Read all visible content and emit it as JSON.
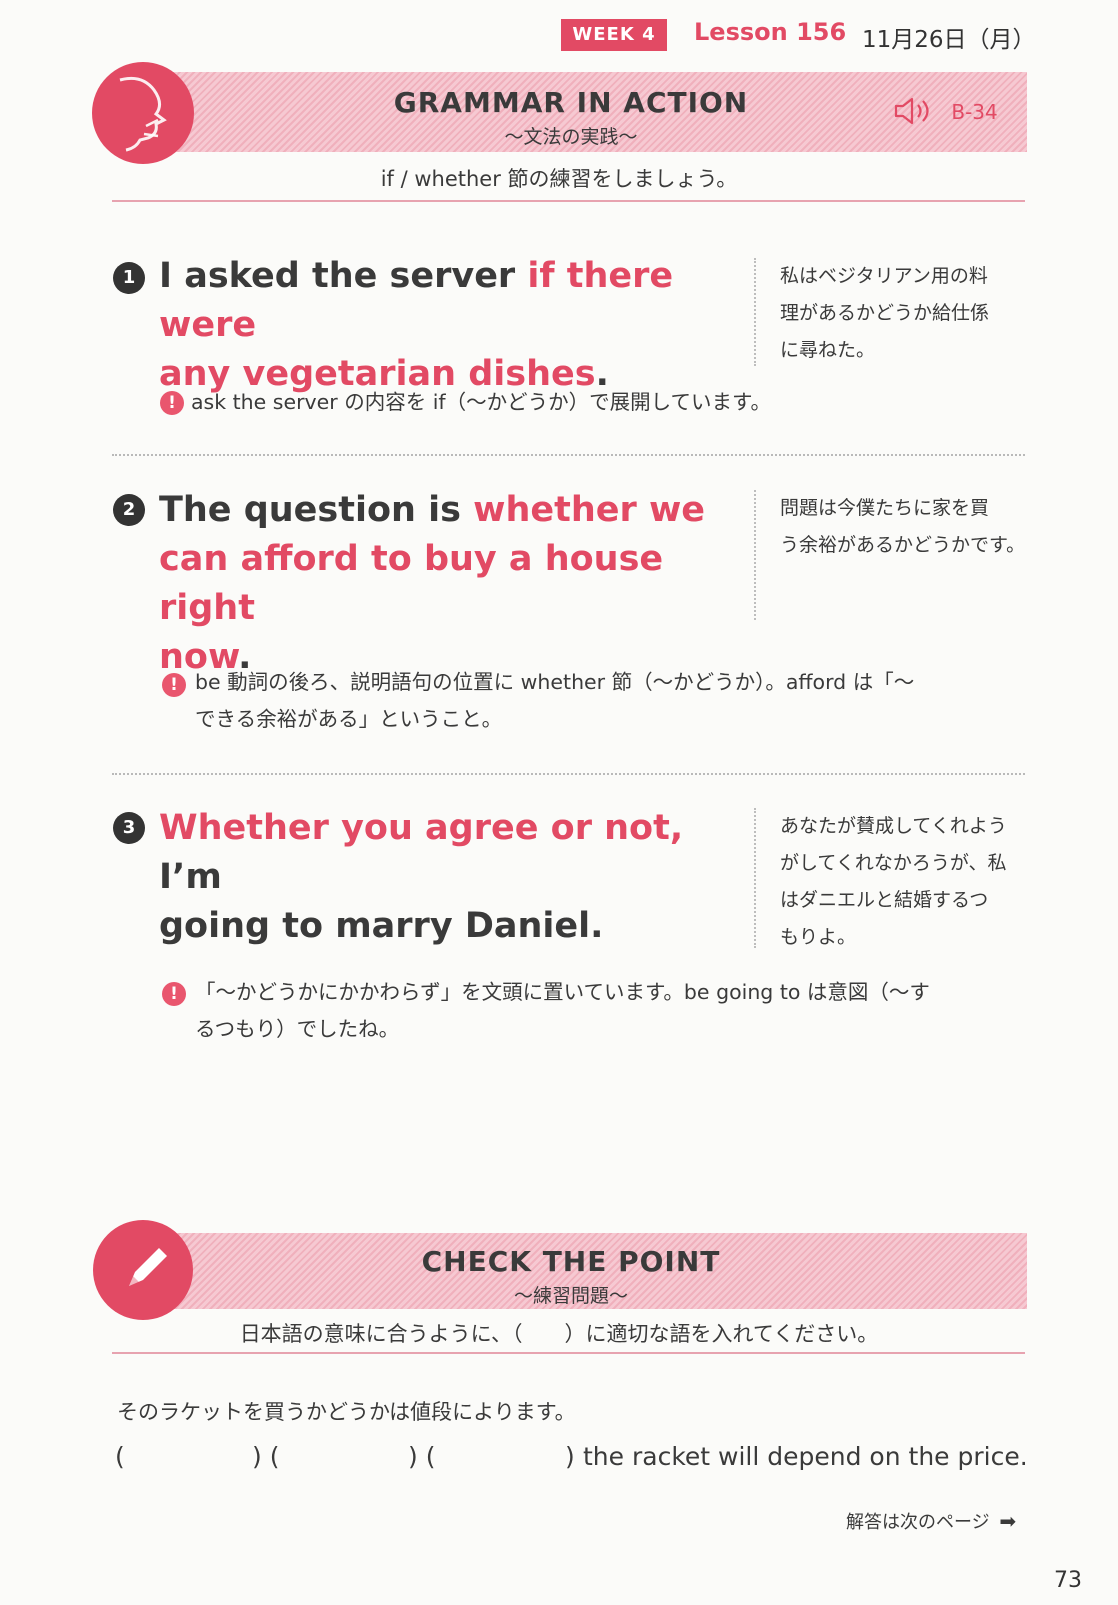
{
  "header": {
    "week": "WEEK 4",
    "lesson": "Lesson 156",
    "date": "11月26日（月）"
  },
  "grammar": {
    "title": "GRAMMAR IN ACTION",
    "subtitle": "～文法の実践～",
    "audio_label": "B-34",
    "instruction": "if / whether 節の練習をしましょう。"
  },
  "items": [
    {
      "number": "1",
      "en_line1_plain": "I asked the server ",
      "en_line1_pink": "if there were",
      "en_line2_pink": "any vegetarian dishes",
      "en_line2_end": ".",
      "jp": [
        "私はベジタリアン用の料",
        "理があるかどうか給仕係",
        "に尋ねた。"
      ],
      "note": [
        "ask the server の内容を if（～かどうか）で展開しています。"
      ]
    },
    {
      "number": "2",
      "en_line1_plain": "The question is ",
      "en_line1_pink": "whether we",
      "en_line2_pink": "can afford to buy a house right",
      "en_line3_pink": "now",
      "en_line3_end": ".",
      "jp": [
        "問題は今僕たちに家を買",
        "う余裕があるかどうかです。"
      ],
      "note": [
        "be 動詞の後ろ、説明語句の位置に whether 節（～かどうか）。afford は「～",
        "できる余裕がある」ということ。"
      ]
    },
    {
      "number": "3",
      "en_line1_pink": "Whether you agree or not, ",
      "en_line1_plain": "I’m",
      "en_line2_plain": "going to marry Daniel.",
      "jp": [
        "あなたが賛成してくれよう",
        "がしてくれなかろうが、私",
        "はダニエルと結婚するつ",
        "もりよ。"
      ],
      "note": [
        "「～かどうかにかかわらず」を文頭に置いています。be going to は意図（～す",
        "るつもり）でしたね。"
      ]
    }
  ],
  "check": {
    "title": "CHECK THE POINT",
    "subtitle": "～練習問題～",
    "instruction": "日本語の意味に合うように、（　　）に適切な語を入れてください。",
    "question_jp": "そのラケットを買うかどうかは値段によります。",
    "blanks": [
      "(",
      ") (",
      ") (",
      ")"
    ],
    "answer_tail": "the racket will depend on the price.",
    "next_page": "解答は次のページ"
  },
  "page_number": "73",
  "colors": {
    "accent": "#e24a64",
    "text": "#3a3a3a",
    "banner": "#f6c9d2"
  }
}
